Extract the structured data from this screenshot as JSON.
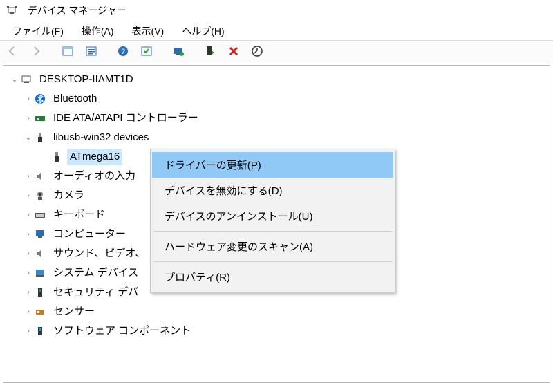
{
  "window": {
    "title": "デバイス マネージャー"
  },
  "menu": {
    "file": "ファイル(F)",
    "action": "操作(A)",
    "view": "表示(V)",
    "help": "ヘルプ(H)"
  },
  "tree_root": "DESKTOP-IIAMT1D",
  "nodes": {
    "bluetooth": "Bluetooth",
    "ide": "IDE ATA/ATAPI コントローラー",
    "libusb": "libusb-win32 devices",
    "atmega": "ATmega16",
    "audio": "オーディオの入力",
    "camera": "カメラ",
    "keyboard": "キーボード",
    "computer": "コンピューター",
    "sound_video": "サウンド、ビデオ、",
    "system_device": "システム デバイス",
    "security_device": "セキュリティ デバ",
    "sensor": "センサー",
    "software_comp": "ソフトウェア コンポーネント"
  },
  "context_menu": {
    "update_driver": "ドライバーの更新(P)",
    "disable_device": "デバイスを無効にする(D)",
    "uninstall_device": "デバイスのアンインストール(U)",
    "scan_hw": "ハードウェア変更のスキャン(A)",
    "properties": "プロパティ(R)"
  }
}
